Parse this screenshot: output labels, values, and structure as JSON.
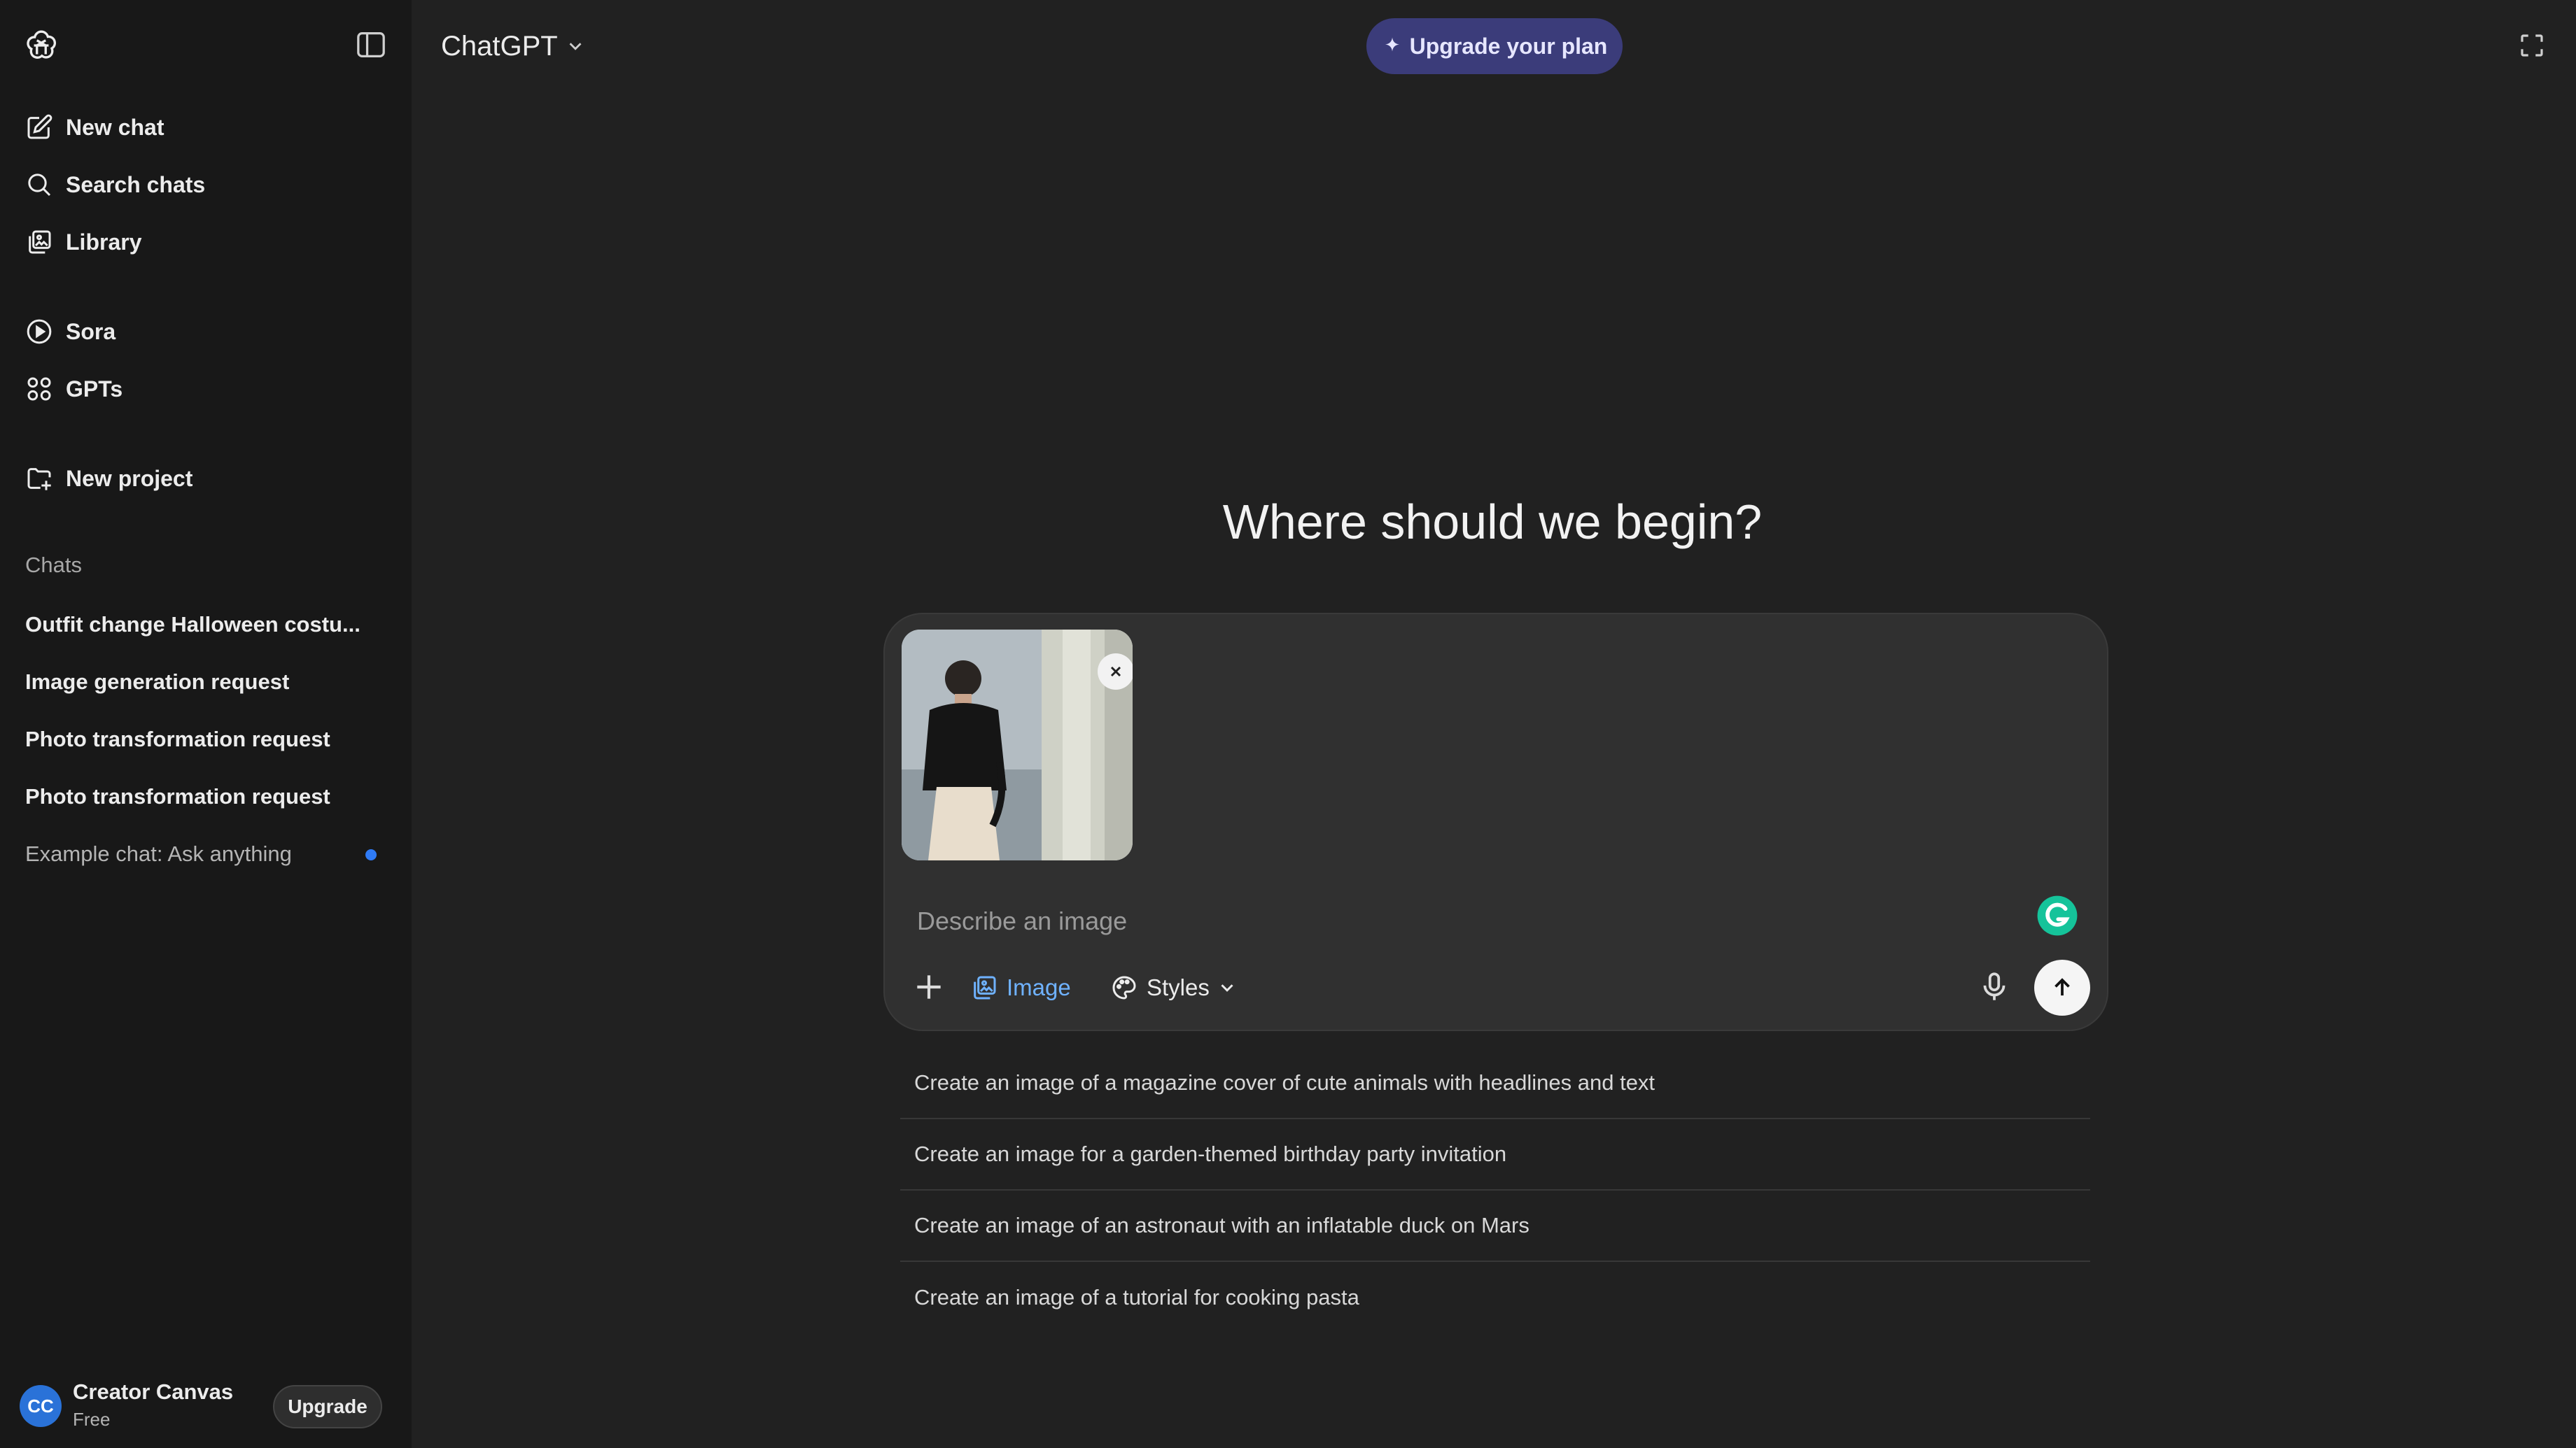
{
  "app": {
    "model_label": "ChatGPT",
    "upgrade_plan_label": "Upgrade your plan"
  },
  "sidebar": {
    "nav": [
      {
        "label": "New chat",
        "icon": "edit-icon"
      },
      {
        "label": "Search chats",
        "icon": "search-icon"
      },
      {
        "label": "Library",
        "icon": "library-icon"
      },
      {
        "label": "Sora",
        "icon": "play-icon"
      },
      {
        "label": "GPTs",
        "icon": "grid-icon"
      },
      {
        "label": "New project",
        "icon": "folder-plus-icon"
      }
    ],
    "chats_label": "Chats",
    "chats": [
      {
        "label": "Outfit change Halloween costu..."
      },
      {
        "label": "Image generation request"
      },
      {
        "label": "Photo transformation request"
      },
      {
        "label": "Photo transformation request"
      },
      {
        "label": "Example chat: Ask anything"
      }
    ],
    "user": {
      "initials": "CC",
      "name": "Creator Canvas",
      "plan": "Free",
      "upgrade_label": "Upgrade"
    }
  },
  "main": {
    "headline": "Where should we begin?",
    "composer": {
      "placeholder": "Describe an image",
      "image_label": "Image",
      "styles_label": "Styles"
    },
    "suggestions": [
      "Create an image of a magazine cover of cute animals with headlines and text",
      "Create an image for a garden-themed birthday party invitation",
      "Create an image of an astronaut with an inflatable duck on Mars",
      "Create an image of a tutorial for cooking pasta"
    ]
  },
  "colors": {
    "background": "#212121",
    "sidebar": "#181818",
    "composer": "#303030",
    "accent_blue": "#6fb2ff",
    "upgrade_plan_bg": "#3b3c7a"
  }
}
